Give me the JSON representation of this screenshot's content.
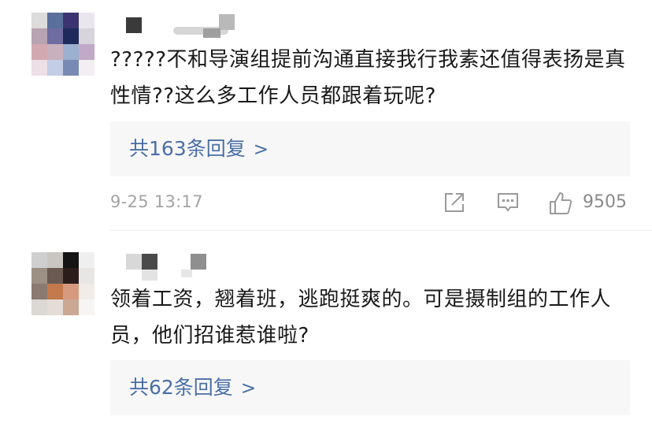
{
  "comments": [
    {
      "text": "?????不和导演组提前沟通直接我行我素还值得表扬是真性情??这么多工作人员都跟着玩呢?",
      "replies_label": "共163条回复",
      "replies_chevron": ">",
      "timestamp": "9-25 13:17",
      "likes": "9505",
      "avatar_colors": [
        "#dcdcdc",
        "#5a6f9a",
        "#3b3470",
        "#eae6ee",
        "#b7a3b1",
        "#6f6ca0",
        "#1f2a5c",
        "#d7d4dc",
        "#d3a9b1",
        "#c9b0bd",
        "#9cb0cf",
        "#c1a9c8",
        "#ecdfe5",
        "#c3cde6",
        "#7889b3",
        "#f2eef1"
      ]
    },
    {
      "text": "领着工资，翘着班，逃跑挺爽的。可是摄制组的工作人员，他们招谁惹谁啦?",
      "replies_label": "共62条回复",
      "replies_chevron": ">",
      "avatar_colors": [
        "#cfcfcf",
        "#c9c6c2",
        "#141414",
        "#efefef",
        "#9c8f84",
        "#6a5a52",
        "#2b1e1a",
        "#e8e6e4",
        "#8a7a72",
        "#c27a4d",
        "#d79a7e",
        "#f1ece8",
        "#dcd8d4",
        "#e4dcd6",
        "#caa894",
        "#f7f5f3"
      ]
    }
  ],
  "icons": {
    "share": "share-icon",
    "reply": "comment-icon",
    "like": "thumbs-up-icon"
  },
  "colors": {
    "link": "#4a6fa5",
    "muted": "#a3a3a3",
    "panel": "#f7f7f7"
  }
}
